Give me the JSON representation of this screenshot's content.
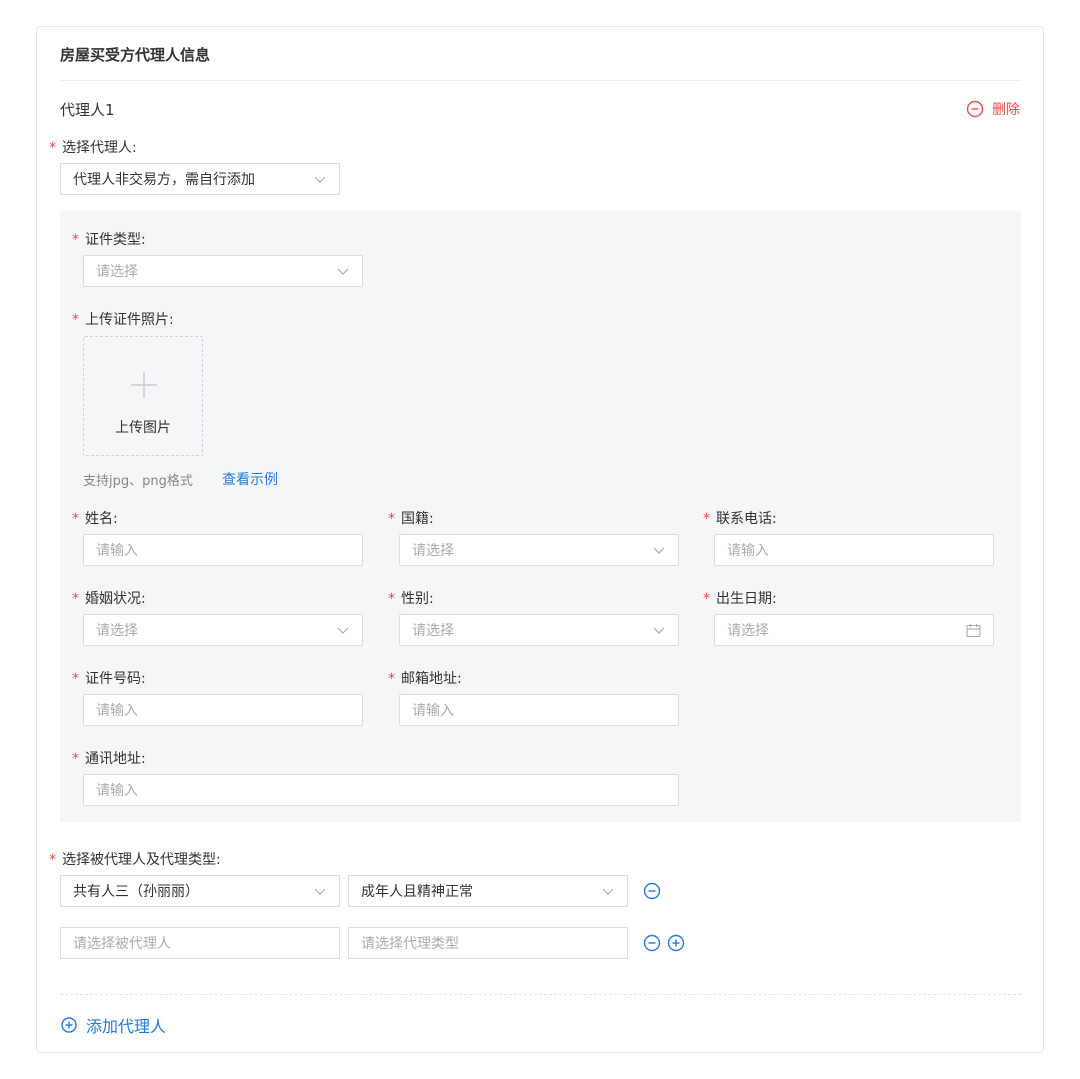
{
  "section_title": "房屋买受方代理人信息",
  "agent": {
    "title": "代理人1",
    "delete_label": "删除",
    "select_agent_label": "选择代理人:",
    "select_agent_value": "代理人非交易方，需自行添加"
  },
  "form": {
    "id_type": {
      "label": "证件类型:",
      "placeholder": "请选择"
    },
    "upload_photo": {
      "label": "上传证件照片:",
      "button_text": "上传图片",
      "hint": "支持jpg、png格式",
      "example_link": "查看示例"
    },
    "name": {
      "label": "姓名:",
      "placeholder": "请输入"
    },
    "nationality": {
      "label": "国籍:",
      "placeholder": "请选择"
    },
    "phone": {
      "label": "联系电话:",
      "placeholder": "请输入"
    },
    "marital": {
      "label": "婚姻状况:",
      "placeholder": "请选择"
    },
    "gender": {
      "label": "性别:",
      "placeholder": "请选择"
    },
    "birth": {
      "label": "出生日期:",
      "placeholder": "请选择"
    },
    "id_number": {
      "label": "证件号码:",
      "placeholder": "请输入"
    },
    "email": {
      "label": "邮箱地址:",
      "placeholder": "请输入"
    },
    "address": {
      "label": "通讯地址:",
      "placeholder": "请输入"
    }
  },
  "principal": {
    "label": "选择被代理人及代理类型:",
    "rows": [
      {
        "principal": "共有人三（孙丽丽）",
        "type": "成年人且精神正常"
      },
      {
        "principal_placeholder": "请选择被代理人",
        "type_placeholder": "请选择代理类型"
      }
    ]
  },
  "add_agent_label": "添加代理人",
  "colors": {
    "accent": "#1f7ae0",
    "danger": "#f04a4a",
    "panel": "#f5f6f7"
  }
}
